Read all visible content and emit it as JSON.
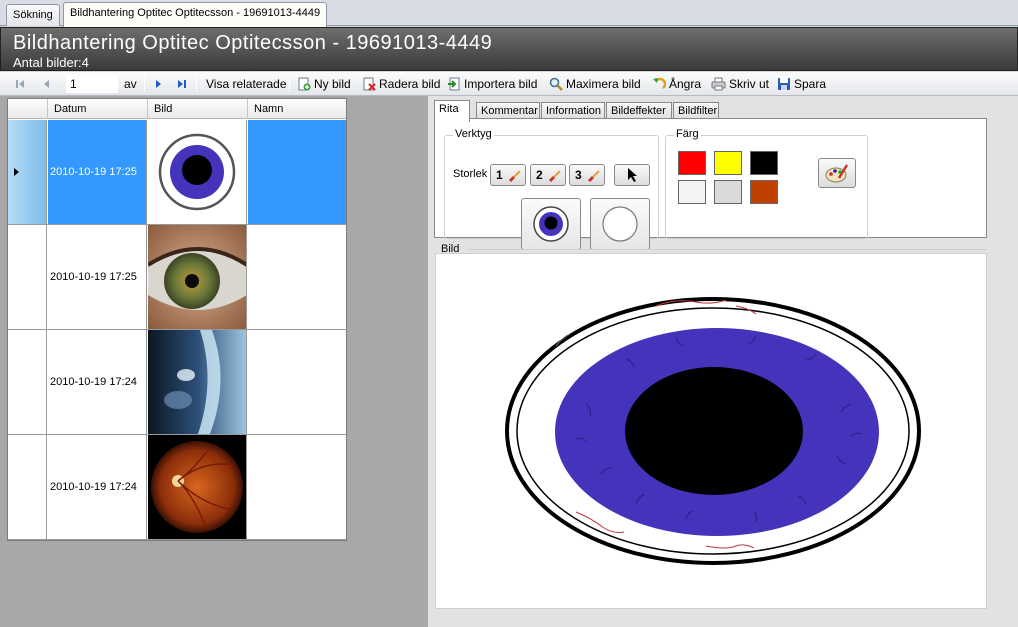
{
  "window_tabs": [
    "Sökning",
    "Bildhantering Optitec Optitecsson - 19691013-4449"
  ],
  "header": {
    "title": "Bildhantering Optitec Optitecsson - 19691013-4449",
    "image_count": "Antal bilder:4"
  },
  "toolbar": {
    "page_value": "1",
    "of_label": "av",
    "show_related": "Visa relaterade",
    "new_image": "Ny bild",
    "delete_image": "Radera bild",
    "import_image": "Importera bild",
    "maximize_image": "Maximera bild",
    "undo": "Ångra",
    "print": "Skriv ut",
    "save": "Spara"
  },
  "grid": {
    "columns": [
      "Datum",
      "Bild",
      "Namn"
    ],
    "rows": [
      {
        "date": "2010-10-19 17:25",
        "thumb": "drawn-eye-icon",
        "name": "",
        "selected": true
      },
      {
        "date": "2010-10-19 17:25",
        "thumb": "eye-photo",
        "name": "",
        "selected": false
      },
      {
        "date": "2010-10-19 17:24",
        "thumb": "cornea-photo",
        "name": "",
        "selected": false
      },
      {
        "date": "2010-10-19 17:24",
        "thumb": "fundus-photo",
        "name": "",
        "selected": false
      }
    ]
  },
  "right_tabs": [
    "Rita",
    "Kommentar",
    "Information",
    "Bildeffekter",
    "Bildfilter"
  ],
  "tools": {
    "group_label": "Verktyg",
    "size_label": "Storlek",
    "sizes": [
      "1",
      "2",
      "3"
    ]
  },
  "colors": {
    "group_label": "Färg",
    "swatches": [
      "#ff0000",
      "#ffff00",
      "#000000",
      "#f4f4f4",
      "#dadada",
      "#bf4000"
    ]
  },
  "image_panel": {
    "label": "Bild",
    "iris_color": "#4433bb",
    "pupil_color": "#000000"
  }
}
